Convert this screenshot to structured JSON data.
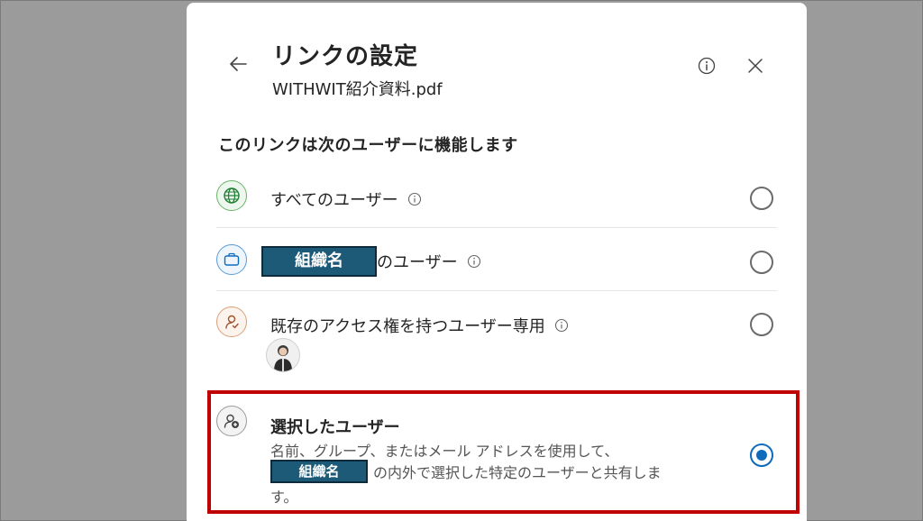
{
  "dialog": {
    "title": "リンクの設定",
    "filename": "WITHWIT紹介資料.pdf",
    "section_heading": "このリンクは次のユーザーに機能します"
  },
  "options": [
    {
      "label": "すべてのユーザー",
      "icon": "globe-icon",
      "selected": false
    },
    {
      "org_name": "組織名",
      "label": "のユーザー",
      "icon": "briefcase-icon",
      "selected": false
    },
    {
      "label": "既存のアクセス権を持つユーザー専用",
      "icon": "person-check-icon",
      "selected": false
    },
    {
      "label": "選択したユーザー",
      "icon": "person-add-icon",
      "selected": true,
      "desc_line1": "名前、グループ、またはメール アドレスを使用して、",
      "org_name": "組織名",
      "desc_line2": "の内外で選択した特定のユーザーと共有しま",
      "desc_line3": "す。"
    }
  ],
  "colors": {
    "accent": "#0f6cbd",
    "highlight": "#c00000",
    "org_box": "#1d5a78",
    "backdrop": "#9b9b9b"
  }
}
